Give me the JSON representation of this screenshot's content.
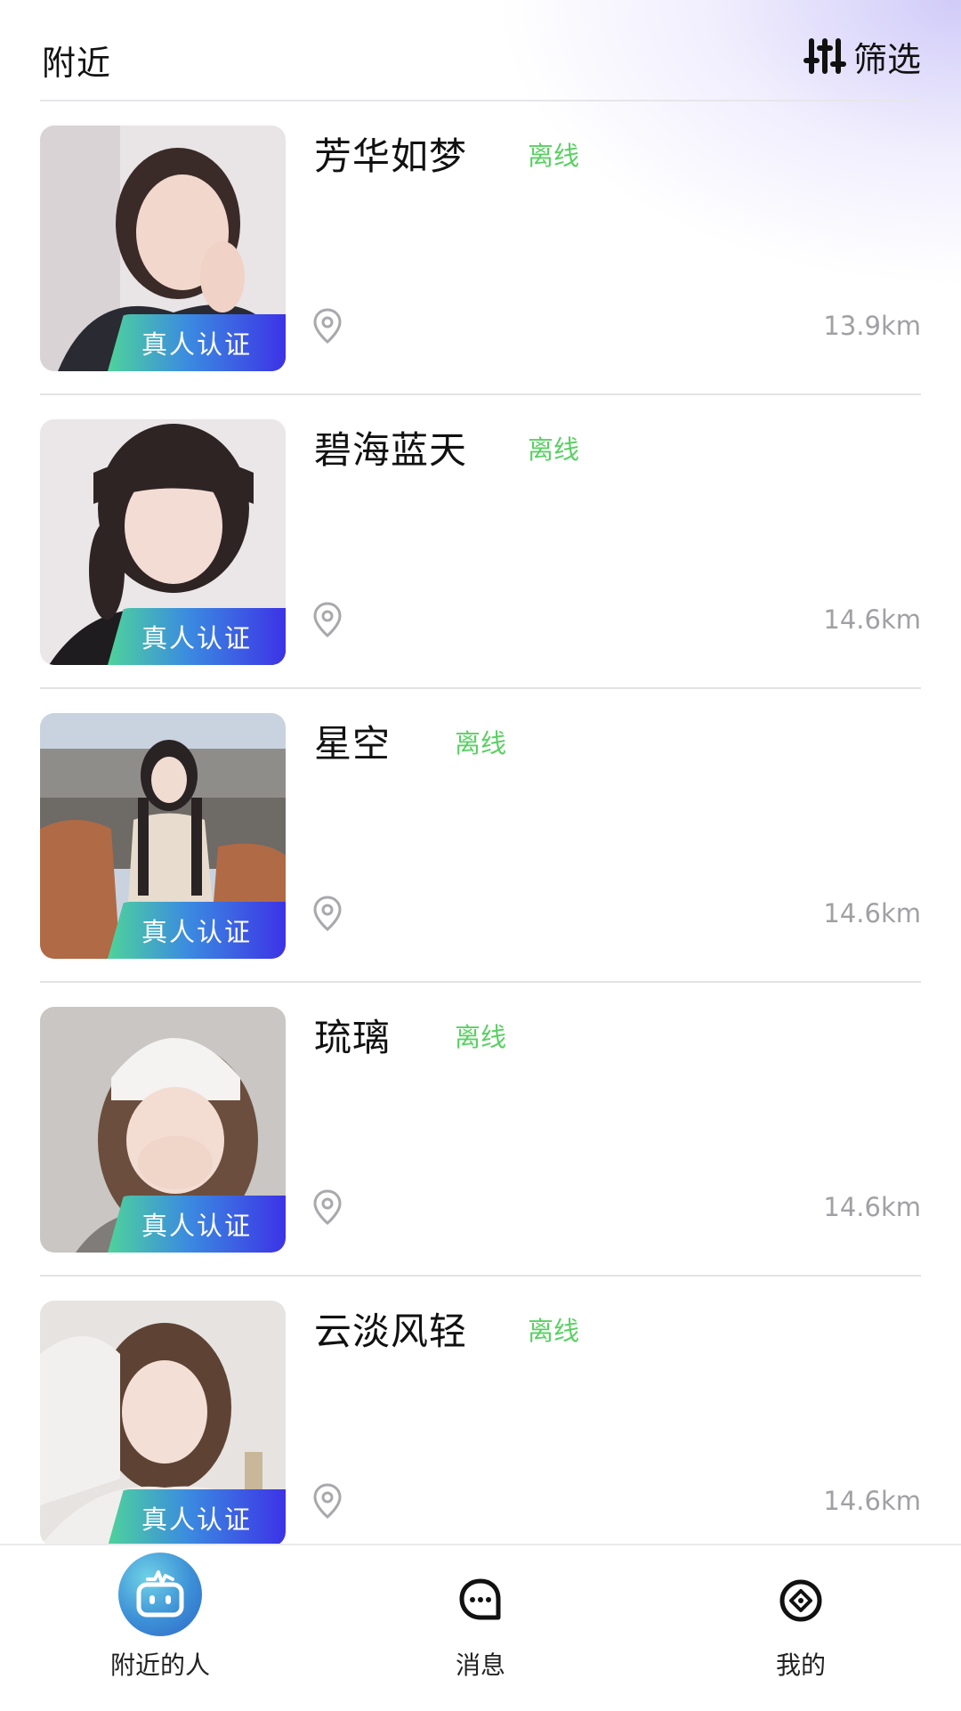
{
  "header": {
    "title": "附近",
    "filter_label": "筛选"
  },
  "people": [
    {
      "name": "芳华如梦",
      "status": "离线",
      "badge": "真人认证",
      "distance": "13.9km",
      "photo_icon": "portrait-photo"
    },
    {
      "name": "碧海蓝天",
      "status": "离线",
      "badge": "真人认证",
      "distance": "14.6km",
      "photo_icon": "portrait-photo"
    },
    {
      "name": "星空",
      "status": "离线",
      "badge": "真人认证",
      "distance": "14.6km",
      "photo_icon": "portrait-photo"
    },
    {
      "name": "琉璃",
      "status": "离线",
      "badge": "真人认证",
      "distance": "14.6km",
      "photo_icon": "portrait-photo"
    },
    {
      "name": "云淡风轻",
      "status": "离线",
      "badge": "真人认证",
      "distance": "14.6km",
      "photo_icon": "portrait-photo"
    }
  ],
  "tabbar": {
    "tabs": [
      {
        "label": "附近的人",
        "icon": "robot-icon",
        "active": true
      },
      {
        "label": "消息",
        "icon": "chat-bubble-icon",
        "active": false
      },
      {
        "label": "我的",
        "icon": "compass-icon",
        "active": false
      }
    ]
  },
  "colors": {
    "status_offline": "#5ad063",
    "badge_gradient_start": "#4ed39a",
    "badge_gradient_end": "#3c33e6",
    "distance_text": "#a0a0a5",
    "active_tab_circle": "#3c8fd6"
  }
}
